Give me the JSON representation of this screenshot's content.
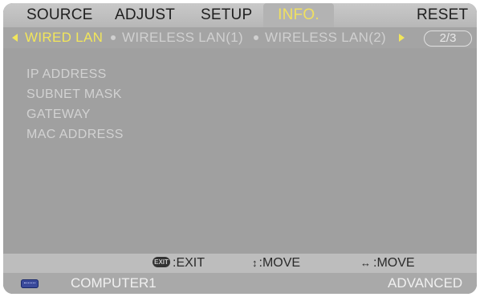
{
  "menu": {
    "items": [
      "SOURCE",
      "ADJUST",
      "SETUP",
      "INFO.",
      "RESET"
    ],
    "active_index": 3
  },
  "subtabs": {
    "items": [
      "WIRED LAN",
      "WIRELESS LAN(1)",
      "WIRELESS LAN(2)"
    ],
    "active_index": 0,
    "page_indicator": "2/3"
  },
  "content": {
    "fields": [
      "IP ADDRESS",
      "SUBNET MASK",
      "GATEWAY",
      "MAC ADDRESS"
    ]
  },
  "help": {
    "exit_key": "EXIT",
    "exit_label": ":EXIT",
    "move_vertical": ":MOVE",
    "move_horizontal": ":MOVE",
    "updown_icon": "↕",
    "leftright_icon": "↔"
  },
  "status": {
    "source_icon": "vga-input-icon",
    "source": "COMPUTER1",
    "mode": "ADVANCED"
  },
  "colors": {
    "active_text": "#f2e65a",
    "background": "#a9a9a9"
  }
}
